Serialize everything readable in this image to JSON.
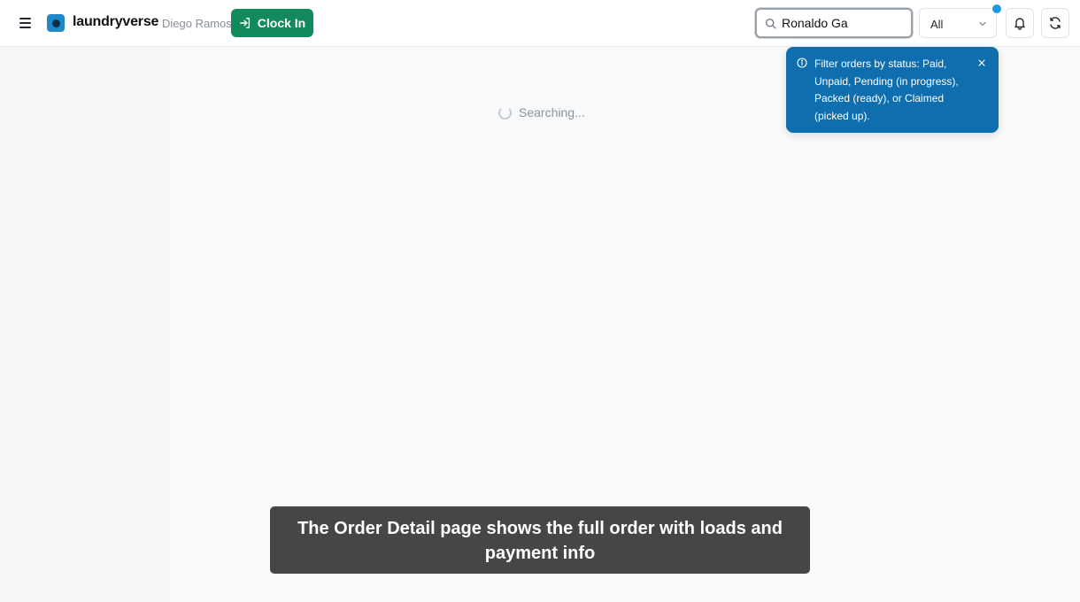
{
  "header": {
    "brand": "laundryverse",
    "user": "Diego Ramos",
    "clock_in_label": "Clock In",
    "search_value": "Ronaldo Ga",
    "status_filter": "All",
    "accent": "#128a5c"
  },
  "main": {
    "status_text": "Searching..."
  },
  "tooltip": {
    "text": "Filter orders by status: Paid, Unpaid, Pending (in progress), Packed (ready), or Claimed (picked up).",
    "bg": "#0f6ead"
  },
  "caption": {
    "text": "The Order Detail page shows the full order with loads and payment info"
  },
  "icons": [
    "menu-icon",
    "logo-icon",
    "login-icon",
    "search-icon",
    "chevron-down-icon",
    "bell-icon",
    "refresh-icon",
    "info-icon",
    "close-icon",
    "spinner-icon"
  ]
}
